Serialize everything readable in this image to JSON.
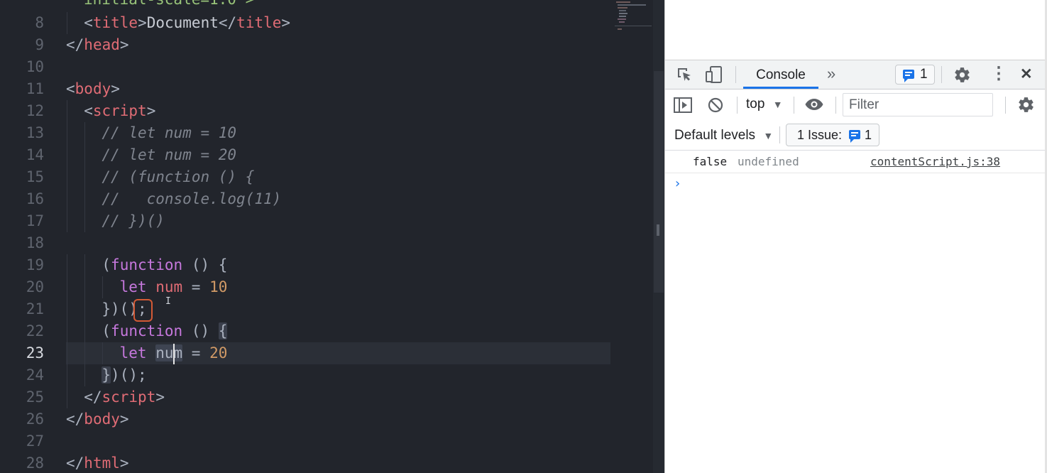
{
  "editor": {
    "lines": [
      {
        "n": "8",
        "tokens": [
          [
            "punc",
            "<"
          ],
          [
            "tag",
            "title"
          ],
          [
            "punc",
            ">"
          ],
          [
            "text",
            "Document"
          ],
          [
            "punc",
            "</"
          ],
          [
            "tag",
            "title"
          ],
          [
            "punc",
            ">"
          ]
        ],
        "indent": 1
      },
      {
        "n": "9",
        "tokens": [
          [
            "punc",
            "</"
          ],
          [
            "tag",
            "head"
          ],
          [
            "punc",
            ">"
          ]
        ],
        "indent": 0
      },
      {
        "n": "10",
        "tokens": [],
        "indent": 0
      },
      {
        "n": "11",
        "tokens": [
          [
            "punc",
            "<"
          ],
          [
            "tag",
            "body"
          ],
          [
            "punc",
            ">"
          ]
        ],
        "indent": 0
      },
      {
        "n": "12",
        "tokens": [
          [
            "punc",
            "<"
          ],
          [
            "tag",
            "script"
          ],
          [
            "punc",
            ">"
          ]
        ],
        "indent": 1
      },
      {
        "n": "13",
        "tokens": [
          [
            "cmt",
            "// let num = 10"
          ]
        ],
        "indent": 2
      },
      {
        "n": "14",
        "tokens": [
          [
            "cmt",
            "// let num = 20"
          ]
        ],
        "indent": 2
      },
      {
        "n": "15",
        "tokens": [
          [
            "cmt",
            "// (function () {"
          ]
        ],
        "indent": 2
      },
      {
        "n": "16",
        "tokens": [
          [
            "cmt",
            "//   console.log(11)"
          ]
        ],
        "indent": 2
      },
      {
        "n": "17",
        "tokens": [
          [
            "cmt",
            "// })()"
          ]
        ],
        "indent": 2
      },
      {
        "n": "18",
        "tokens": [],
        "indent": 0
      },
      {
        "n": "19",
        "tokens": [
          [
            "punc",
            "("
          ],
          [
            "kw",
            "function"
          ],
          [
            "punc",
            " () {"
          ]
        ],
        "indent": 2
      },
      {
        "n": "20",
        "tokens": [
          [
            "kw",
            "let"
          ],
          [
            "punc",
            " "
          ],
          [
            "var",
            "num"
          ],
          [
            "punc",
            " = "
          ],
          [
            "num",
            "10"
          ]
        ],
        "indent": 3
      },
      {
        "n": "21",
        "tokens": [
          [
            "punc",
            "})()"
          ],
          [
            "punc",
            ";"
          ]
        ],
        "indent": 2
      },
      {
        "n": "22",
        "tokens": [
          [
            "punc",
            "("
          ],
          [
            "kw",
            "function"
          ],
          [
            "punc",
            " () "
          ],
          [
            "brk",
            "{"
          ]
        ],
        "indent": 2
      },
      {
        "n": "23",
        "tokens": [
          [
            "kw",
            "let"
          ],
          [
            "punc",
            " "
          ],
          [
            "wordhl",
            "num"
          ],
          [
            "punc",
            " = "
          ],
          [
            "num",
            "20"
          ]
        ],
        "indent": 3,
        "active": true
      },
      {
        "n": "24",
        "tokens": [
          [
            "brk",
            "}"
          ],
          [
            "punc",
            ")();"
          ]
        ],
        "indent": 2
      },
      {
        "n": "25",
        "tokens": [
          [
            "punc",
            "</"
          ],
          [
            "tag",
            "script"
          ],
          [
            "punc",
            ">"
          ]
        ],
        "indent": 1
      },
      {
        "n": "26",
        "tokens": [
          [
            "punc",
            "</"
          ],
          [
            "tag",
            "body"
          ],
          [
            "punc",
            ">"
          ]
        ],
        "indent": 0
      },
      {
        "n": "27",
        "tokens": [],
        "indent": 0
      },
      {
        "n": "28",
        "tokens": [
          [
            "punc",
            "</"
          ],
          [
            "tag",
            "html"
          ],
          [
            "punc",
            ">"
          ]
        ],
        "indent": 0
      }
    ],
    "partial_top_line": "initial-scale=1.0\">",
    "cursor_glyph": "I"
  },
  "devtools": {
    "toolbar": {
      "console_tab": "Console",
      "more_tabs": "»",
      "issues_count": "1",
      "menu_icon": "⋮",
      "close_icon": "✕"
    },
    "filter": {
      "context": "top",
      "context_arrow": "▼",
      "placeholder": "Filter"
    },
    "levels": {
      "label": "Default levels",
      "arrow": "▼",
      "issues_label": "1 Issue:",
      "issues_count": "1"
    },
    "console": {
      "message_false": "false",
      "message_undefined": "undefined",
      "source": "contentScript.js:38",
      "prompt": "›"
    }
  }
}
